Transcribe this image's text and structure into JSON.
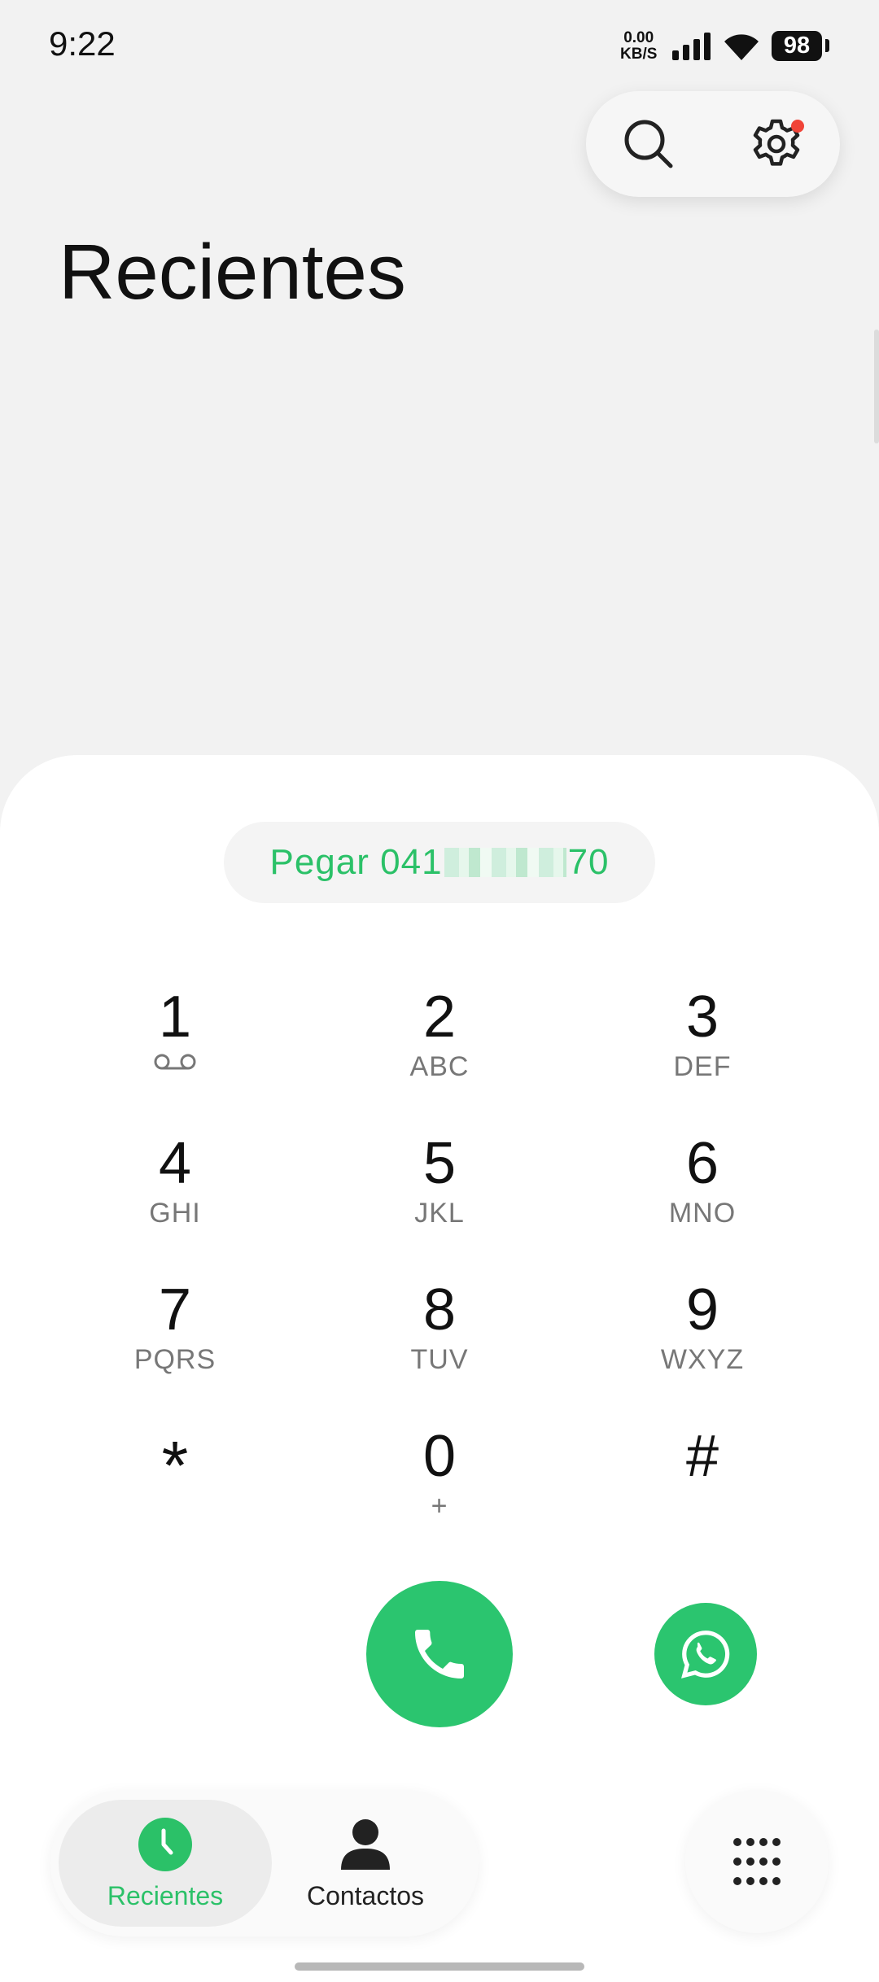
{
  "status_bar": {
    "time": "9:22",
    "net_speed_value": "0.00",
    "net_speed_unit": "KB/S",
    "battery": "98"
  },
  "header": {
    "title": "Recientes",
    "search_icon": "search-icon",
    "settings_icon": "gear-icon",
    "notification_color": "#f04438"
  },
  "paste": {
    "label": "Pegar",
    "number_prefix": "041",
    "number_suffix": "70",
    "color": "#2bc168"
  },
  "keypad": {
    "keys": [
      {
        "digit": "1",
        "letters": "",
        "icon": "voicemail-icon"
      },
      {
        "digit": "2",
        "letters": "ABC"
      },
      {
        "digit": "3",
        "letters": "DEF"
      },
      {
        "digit": "4",
        "letters": "GHI"
      },
      {
        "digit": "5",
        "letters": "JKL"
      },
      {
        "digit": "6",
        "letters": "MNO"
      },
      {
        "digit": "7",
        "letters": "PQRS"
      },
      {
        "digit": "8",
        "letters": "TUV"
      },
      {
        "digit": "9",
        "letters": "WXYZ"
      },
      {
        "digit": "*",
        "letters": ""
      },
      {
        "digit": "0",
        "letters": "+"
      },
      {
        "digit": "#",
        "letters": ""
      }
    ]
  },
  "actions": {
    "call_icon": "phone-icon",
    "whatsapp_icon": "whatsapp-icon",
    "accent": "#2bc56f"
  },
  "nav": {
    "recents_label": "Recientes",
    "contacts_label": "Contactos",
    "keypad_icon": "dialpad-icon"
  }
}
